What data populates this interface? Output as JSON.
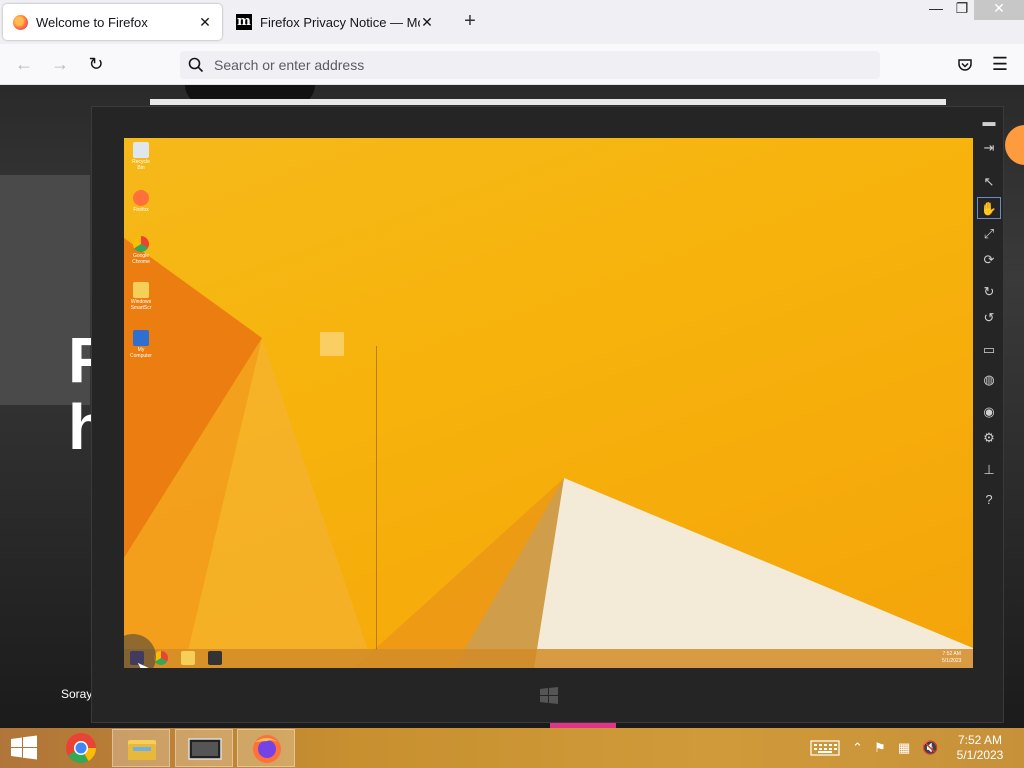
{
  "browser": {
    "tabs": [
      {
        "title": "Welcome to Firefox",
        "active": true,
        "icon": "firefox-icon"
      },
      {
        "title": "Firefox Privacy Notice — Mozilla",
        "active": false,
        "icon": "mozilla-m-icon"
      }
    ],
    "new_tab_symbol": "+",
    "close_symbol": "✕",
    "window_controls": {
      "minimize": "—",
      "maximize": "❐",
      "close": "✕"
    },
    "nav": {
      "back": "←",
      "forward": "→",
      "reload": "↻",
      "menu": "☰"
    },
    "address_placeholder": "Search or enter address"
  },
  "page": {
    "hero_line1": "F",
    "hero_line2": "h",
    "caption": "Soray"
  },
  "remote_desktop": {
    "desktop_icons": [
      {
        "label": "Recycle Bin",
        "icon": "recycle-bin-icon",
        "color": "#dfe6ee"
      },
      {
        "label": "Firefox",
        "icon": "firefox-icon",
        "color": "#ff7139"
      },
      {
        "label": "Google Chrome",
        "icon": "chrome-icon",
        "color": "#3b82f6"
      },
      {
        "label": "Windows SmartScr",
        "icon": "folder-icon",
        "color": "#f5cf57"
      },
      {
        "label": "My Computer",
        "icon": "computer-icon",
        "color": "#2f6fd1"
      }
    ],
    "tray_time": "7:52 AM",
    "tray_date": "5/1/2023",
    "toolbar": [
      "minimize-icon",
      "pin-icon",
      "pointer-icon",
      "hand-icon",
      "zoom-icon",
      "scroll-icon",
      "rotate-cw-icon",
      "rotate-ccw-icon",
      "monitor-icon",
      "globe-icon",
      "camera-icon",
      "gear-icon",
      "connect-icon",
      "help-icon"
    ],
    "toolbar_glyphs": [
      "▬",
      "⇥",
      "↖",
      "✋",
      "⤢",
      "⟳",
      "↻",
      "↺",
      "▭",
      "◍",
      "◉",
      "⚙",
      "⊥",
      "?"
    ]
  },
  "taskbar": {
    "apps": [
      {
        "name": "chrome",
        "icon": "chrome-icon",
        "running": false
      },
      {
        "name": "file-explorer",
        "icon": "folder-icon",
        "running": true
      },
      {
        "name": "remote-desktop",
        "icon": "remote-desktop-icon",
        "running": true
      },
      {
        "name": "firefox",
        "icon": "firefox-icon",
        "running": true
      }
    ],
    "clock_time": "7:52 AM",
    "clock_date": "5/1/2023"
  },
  "colors": {
    "accent_firefox": "#ff7139",
    "remote_wallpaper": "#f7b30c",
    "taskbar": "#c8902f"
  }
}
